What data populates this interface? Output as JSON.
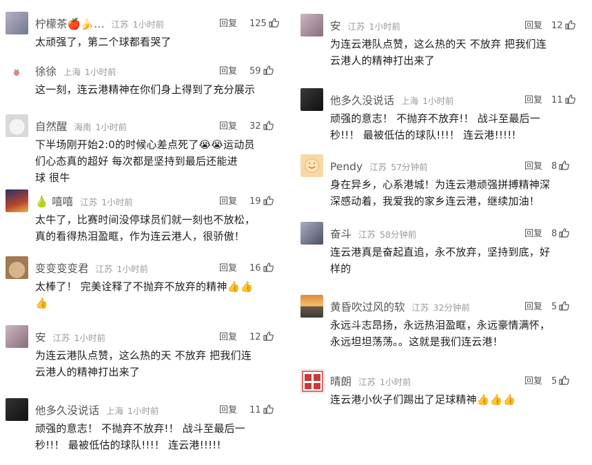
{
  "reply_label": "回复",
  "left_comments": [
    {
      "user": "柠檬茶🍎🍌…",
      "location": "江苏",
      "time": "1小时前",
      "likes": "125",
      "text": [
        "太顽强了，第二个球都看哭了"
      ]
    },
    {
      "user": "徐徐",
      "location": "上海",
      "time": "1小时前",
      "likes": "59",
      "text": [
        "这一刻，连云港精神在你们身上得到了充分展示"
      ]
    },
    {
      "user": "自然醒",
      "location": "海南",
      "time": "1小时前",
      "likes": "32",
      "text": [
        "下半场刚开始2:0的时候心差点死了😭😭运动员",
        "们心态真的超好 每次都是坚持到最后还能进",
        "球 很牛"
      ]
    },
    {
      "user": "🍐 嘻嘻",
      "location": "江苏",
      "time": "1小时前",
      "likes": "19",
      "text": [
        "太牛了，比赛时间没停球员们就一刻也不放松，",
        "真的看得热泪盈眶，作为连云港人，很骄傲！"
      ]
    },
    {
      "user": "变变变变君",
      "location": "江苏",
      "time": "1小时前",
      "likes": "16",
      "text": [
        "太棒了！ 完美诠释了不抛弃不放弃的精神👍👍",
        "👍"
      ]
    },
    {
      "user": "安",
      "location": "江苏",
      "time": "1小时前",
      "likes": "12",
      "text": [
        "为连云港队点赞，这么热的天 不放弃 把我们连",
        "云港人的精神打出来了"
      ]
    },
    {
      "user": "他多久没说话",
      "location": "上海",
      "time": "1小时前",
      "likes": "11",
      "text": [
        "顽强的意志！ 不抛弃不放弃!！ 战斗至最后一",
        "秒!!！ 最被低估的球队!!!！ 连云港!!!!!"
      ]
    }
  ],
  "right_comments": [
    {
      "user": "安",
      "location": "江苏",
      "time": "1小时前",
      "likes": "12",
      "text": [
        "为连云港队点赞，这么热的天 不放弃 把我们连",
        "云港人的精神打出来了"
      ]
    },
    {
      "user": "他多久没说话",
      "location": "上海",
      "time": "1小时前",
      "likes": "11",
      "text": [
        "顽强的意志！ 不抛弃不放弃!！ 战斗至最后一",
        "秒!!！ 最被低估的球队!!!！ 连云港!!!!!"
      ]
    },
    {
      "user": "Pendy",
      "location": "江苏",
      "time": "57分钟前",
      "likes": "8",
      "text": [
        "身在异乡，心系港城！为连云港顽强拼搏精神深",
        "深感动着，我爱我的家乡连云港，继续加油！"
      ]
    },
    {
      "user": "奋斗",
      "location": "江苏",
      "time": "58分钟前",
      "likes": "8",
      "text": [
        "连云港真是奋起直追，永不放弃，坚持到底，好",
        "样的"
      ]
    },
    {
      "user": "黄昏吹过风的软",
      "location": "江苏",
      "time": "32分钟前",
      "likes": "5",
      "text": [
        "永远斗志昂扬，永远热泪盈眶，永远豪情满怀，",
        "永远坦坦荡荡。。这就是我们连云港！"
      ]
    },
    {
      "user": "晴朗",
      "location": "江苏",
      "time": "1小时前",
      "likes": "5",
      "text": [
        "连云港小伙子们踢出了足球精神👍👍👍"
      ]
    }
  ]
}
